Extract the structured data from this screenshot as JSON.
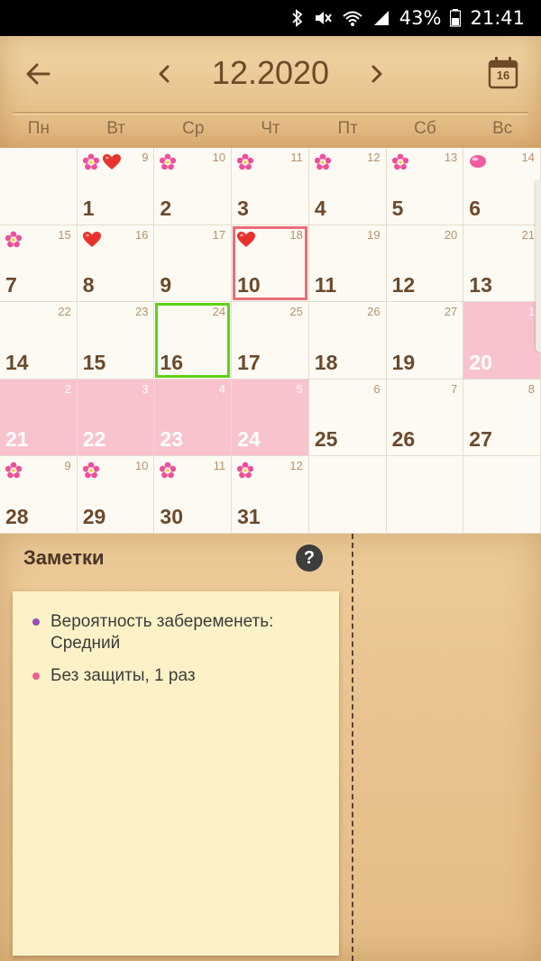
{
  "status_bar": {
    "battery": "43%",
    "time": "21:41"
  },
  "header": {
    "month_title": "12.2020",
    "today_icon_number": "16"
  },
  "weekdays": [
    "Пн",
    "Вт",
    "Ср",
    "Чт",
    "Пт",
    "Сб",
    "Вс"
  ],
  "calendar": {
    "cells": [
      {
        "day": "",
        "lunar": ""
      },
      {
        "day": "1",
        "lunar": "9",
        "icons": [
          "flower",
          "heart"
        ]
      },
      {
        "day": "2",
        "lunar": "10",
        "icons": [
          "flower"
        ]
      },
      {
        "day": "3",
        "lunar": "11",
        "icons": [
          "flower"
        ]
      },
      {
        "day": "4",
        "lunar": "12",
        "icons": [
          "flower"
        ]
      },
      {
        "day": "5",
        "lunar": "13",
        "icons": [
          "flower"
        ]
      },
      {
        "day": "6",
        "lunar": "14",
        "icons": [
          "egg"
        ]
      },
      {
        "day": "7",
        "lunar": "15",
        "icons": [
          "flower"
        ]
      },
      {
        "day": "8",
        "lunar": "16",
        "icons": [
          "heart"
        ]
      },
      {
        "day": "9",
        "lunar": "17"
      },
      {
        "day": "10",
        "lunar": "18",
        "icons": [
          "heart"
        ],
        "today": true
      },
      {
        "day": "11",
        "lunar": "19"
      },
      {
        "day": "12",
        "lunar": "20"
      },
      {
        "day": "13",
        "lunar": "21"
      },
      {
        "day": "14",
        "lunar": "22"
      },
      {
        "day": "15",
        "lunar": "23"
      },
      {
        "day": "16",
        "lunar": "24",
        "selected": true
      },
      {
        "day": "17",
        "lunar": "25"
      },
      {
        "day": "18",
        "lunar": "26"
      },
      {
        "day": "19",
        "lunar": "27"
      },
      {
        "day": "20",
        "lunar": "1",
        "period": true
      },
      {
        "day": "21",
        "lunar": "2",
        "period": true
      },
      {
        "day": "22",
        "lunar": "3",
        "period": true
      },
      {
        "day": "23",
        "lunar": "4",
        "period": true
      },
      {
        "day": "24",
        "lunar": "5",
        "period": true
      },
      {
        "day": "25",
        "lunar": "6"
      },
      {
        "day": "26",
        "lunar": "7"
      },
      {
        "day": "27",
        "lunar": "8"
      },
      {
        "day": "28",
        "lunar": "9",
        "icons": [
          "flower"
        ]
      },
      {
        "day": "29",
        "lunar": "10",
        "icons": [
          "flower"
        ]
      },
      {
        "day": "30",
        "lunar": "11",
        "icons": [
          "flower"
        ]
      },
      {
        "day": "31",
        "lunar": "12",
        "icons": [
          "flower"
        ]
      },
      {
        "day": "",
        "lunar": ""
      },
      {
        "day": "",
        "lunar": ""
      },
      {
        "day": "",
        "lunar": ""
      }
    ],
    "colors": {
      "period_fill": "#f9c3cd",
      "today_border": "#e96d77",
      "selected_border": "#5ed11a"
    }
  },
  "notes": {
    "title": "Заметки",
    "help_label": "?",
    "items": [
      {
        "text": "Вероятность забеременеть: Средний",
        "bullet_color": "#9b4fb8"
      },
      {
        "text": "Без защиты, 1 раз",
        "bullet_color": "#ee5f8f"
      }
    ]
  }
}
